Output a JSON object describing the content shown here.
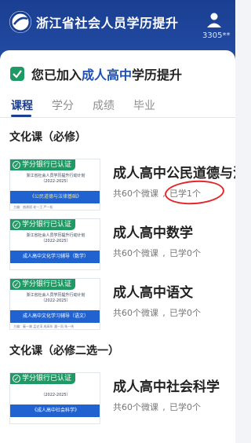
{
  "header": {
    "app_title": "浙江省社会人员学历提升",
    "user_id": "3305**",
    "brand_color": "#1a3f92",
    "logo_icon": "ring-logo-icon",
    "user_icon": "person-icon"
  },
  "card": {
    "title_prefix": "您已加入",
    "title_highlight": "成人高中",
    "title_suffix": "学历提升",
    "status_icon": "shield-check-icon"
  },
  "tabs": [
    {
      "label": "课程",
      "active": true
    },
    {
      "label": "学分",
      "active": false
    },
    {
      "label": "成绩",
      "active": false
    },
    {
      "label": "毕业",
      "active": false
    }
  ],
  "sections": [
    {
      "title": "文化课（必修）"
    },
    {
      "title": "文化课（必修二选一）"
    }
  ],
  "badge_text": "学分银行已认证",
  "courses": [
    {
      "name": "成人高中公民道德与法",
      "total": "共60个微课",
      "learned": "已学1个",
      "thumb_plan": "浙江省社会人员学历提升行动计划",
      "thumb_years": "（2022-2025）",
      "thumb_band": "《公民道德与法律基础》",
      "thumb_foot": "主编：曲建斌  老一王  严一松",
      "has_badge": true,
      "highlighted": true
    },
    {
      "name": "成人高中数学",
      "total": "共60个微课",
      "learned": "已学0个",
      "thumb_plan": "浙江省社会人员学历提升行动计划",
      "thumb_years": "（2022-2025）",
      "thumb_band": "成人高中文化学习辅导（数学）",
      "thumb_foot": "",
      "has_badge": true,
      "highlighted": false
    },
    {
      "name": "成人高中语文",
      "total": "共60个微课",
      "learned": "已学0个",
      "thumb_plan": "浙江省社会人员学历提升行动计划",
      "thumb_years": "（2022-2025）",
      "thumb_band": "成人高中文化学习辅导（语文）",
      "thumb_foot": "主编：秦一端  孟史涛  成高年  潘一凤  朱一伟",
      "has_badge": true,
      "highlighted": false
    },
    {
      "name": "成人高中社会科学",
      "total": "共60个微课",
      "learned": "已学0个",
      "thumb_plan": "",
      "thumb_years": "（2022-2025）",
      "thumb_band": "《成人高中社会科学》",
      "thumb_foot": "",
      "has_badge": true,
      "highlighted": false
    }
  ]
}
